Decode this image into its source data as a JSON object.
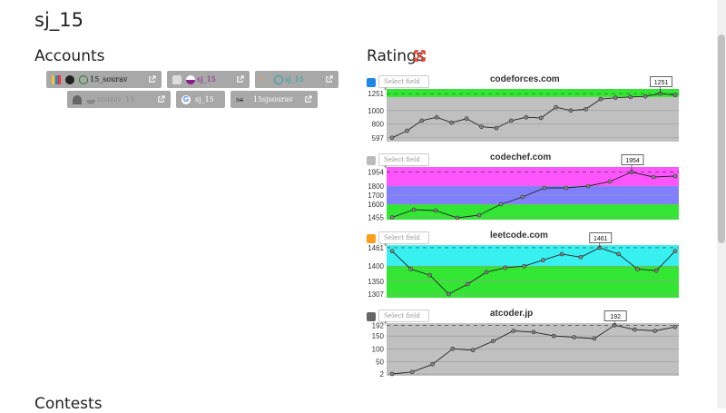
{
  "page": {
    "title": "sj_15"
  },
  "accounts": {
    "heading": "Accounts",
    "items": [
      {
        "site": "codeforces",
        "label": "15_sourav",
        "color": "#111111",
        "icon": "codeforces-icon"
      },
      {
        "site": "codechef",
        "label": "sj_15",
        "color": "#8a1b8a",
        "icon": "codechef-icon"
      },
      {
        "site": "leetcode",
        "label": "sj_15",
        "color": "#1aa3a3",
        "icon": "leetcode-icon"
      },
      {
        "site": "atcoder",
        "label": "sourav_15",
        "color": "#8c8c8c",
        "icon": "atcoder-icon"
      },
      {
        "site": "google",
        "label": "sj_15",
        "color": "#ffffff",
        "icon": "google-icon"
      },
      {
        "site": "other",
        "label": "15sjsourav",
        "color": "#ffffff",
        "icon": "ac-icon"
      }
    ]
  },
  "ratings": {
    "heading": "Ratings"
  },
  "contests": {
    "heading": "Contests"
  },
  "select_placeholder": "Select field",
  "charts": [
    {
      "title": "codeforces.com",
      "type": "line",
      "yticks": [
        "1251",
        "1000",
        "800",
        "597"
      ],
      "ylim": [
        540,
        1320
      ],
      "current": "1251",
      "bands": [
        {
          "from": 540,
          "to": 1200,
          "color": "#c0c0c0"
        },
        {
          "from": 1200,
          "to": 1320,
          "color": "#33e633"
        }
      ],
      "values": [
        597,
        700,
        850,
        900,
        820,
        880,
        760,
        740,
        850,
        900,
        890,
        1050,
        1000,
        1020,
        1170,
        1190,
        1200,
        1210,
        1251,
        1230
      ]
    },
    {
      "title": "codechef.com",
      "type": "line",
      "yticks": [
        "1954",
        "1800",
        "1700",
        "1600",
        "1455"
      ],
      "ylim": [
        1430,
        2010
      ],
      "current": "1954",
      "bands": [
        {
          "from": 1430,
          "to": 1600,
          "color": "#33e633"
        },
        {
          "from": 1600,
          "to": 1800,
          "color": "#8080ff"
        },
        {
          "from": 1800,
          "to": 2010,
          "color": "#ff55ff"
        }
      ],
      "values": [
        1455,
        1540,
        1530,
        1450,
        1480,
        1600,
        1680,
        1780,
        1780,
        1800,
        1850,
        1954,
        1900,
        1910
      ]
    },
    {
      "title": "leetcode.com",
      "type": "line",
      "yticks": [
        "1461",
        "1400",
        "1350",
        "1307"
      ],
      "ylim": [
        1295,
        1470
      ],
      "current": "1461",
      "bands": [
        {
          "from": 1295,
          "to": 1400,
          "color": "#33e633"
        },
        {
          "from": 1400,
          "to": 1470,
          "color": "#39f0f0"
        }
      ],
      "values": [
        1450,
        1390,
        1370,
        1307,
        1340,
        1380,
        1395,
        1400,
        1420,
        1440,
        1430,
        1461,
        1440,
        1390,
        1385,
        1450
      ]
    },
    {
      "title": "atcoder.jp",
      "type": "line",
      "yticks": [
        "192",
        "150",
        "100",
        "50",
        "2"
      ],
      "ylim": [
        -5,
        200
      ],
      "current": "192",
      "bands": [
        {
          "from": -5,
          "to": 200,
          "color": "#c0c0c0"
        }
      ],
      "values": [
        2,
        10,
        40,
        100,
        95,
        130,
        170,
        165,
        150,
        145,
        140,
        192,
        175,
        170,
        185
      ]
    }
  ]
}
